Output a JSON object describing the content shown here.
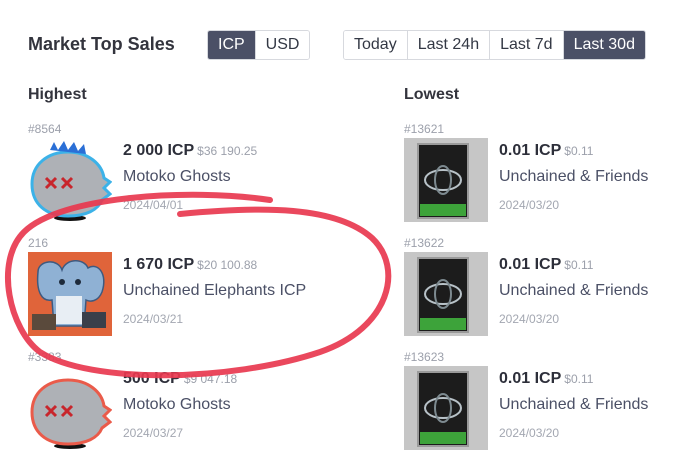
{
  "header": {
    "title": "Market Top Sales",
    "currency_options": [
      {
        "label": "ICP",
        "active": true
      },
      {
        "label": "USD",
        "active": false
      }
    ],
    "period_options": [
      {
        "label": "Today",
        "active": false
      },
      {
        "label": "Last 24h",
        "active": false
      },
      {
        "label": "Last 7d",
        "active": false
      },
      {
        "label": "Last 30d",
        "active": true
      }
    ]
  },
  "highest": {
    "label": "Highest",
    "items": [
      {
        "id": "#8564",
        "price": "2 000 ICP",
        "usd": "$36 190.25",
        "collection": "Motoko Ghosts",
        "date": "2024/04/01",
        "thumb": "ghost-icon"
      },
      {
        "id": "216",
        "price": "1 670 ICP",
        "usd": "$20 100.88",
        "collection": "Unchained Elephants ICP",
        "date": "2024/03/21",
        "thumb": "elephant-icon"
      },
      {
        "id": "#3383",
        "price": "500 ICP",
        "usd": "$9 047.18",
        "collection": "Motoko Ghosts",
        "date": "2024/03/27",
        "thumb": "ghost-icon"
      }
    ]
  },
  "lowest": {
    "label": "Lowest",
    "items": [
      {
        "id": "#13621",
        "price": "0.01 ICP",
        "usd": "$0.11",
        "collection": "Unchained & Friends",
        "date": "2024/03/20",
        "thumb": "card-icon"
      },
      {
        "id": "#13622",
        "price": "0.01 ICP",
        "usd": "$0.11",
        "collection": "Unchained & Friends",
        "date": "2024/03/20",
        "thumb": "card-icon"
      },
      {
        "id": "#13623",
        "price": "0.01 ICP",
        "usd": "$0.11",
        "collection": "Unchained & Friends",
        "date": "2024/03/20",
        "thumb": "card-icon"
      }
    ]
  },
  "colors": {
    "accent": "#4b5066",
    "annotation": "#e8384f"
  }
}
